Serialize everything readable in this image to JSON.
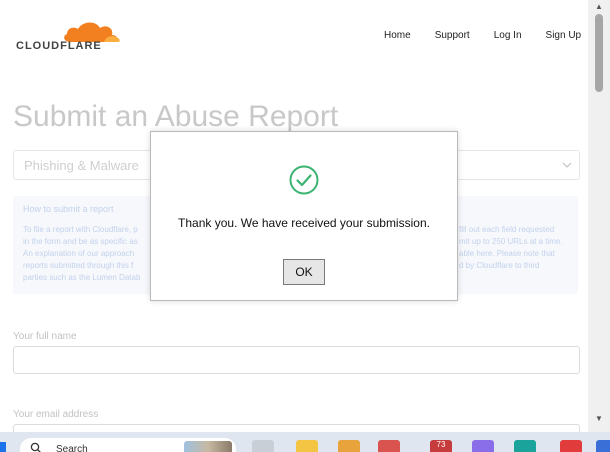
{
  "header": {
    "logo_text": "CLOUDFLARE",
    "nav": [
      "Home",
      "Support",
      "Log In",
      "Sign Up"
    ]
  },
  "main": {
    "title": "Submit an Abuse Report",
    "report_type_value": "Phishing & Malware",
    "info_title": "How to submit a report",
    "info_lines": [
      "To file a report with Cloudflare, p",
      "in the form and be as specific as",
      "An explanation of our approach",
      "reports submitted through this f",
      "parties such as the Lumen Datab"
    ],
    "info_lines_right": [
      "fill out each field requested",
      "mit up to 250 URLs at a time.",
      "able here. Please note that",
      "d by Cloudflare to third"
    ],
    "full_name_label": "Your full name",
    "email_label": "Your email address"
  },
  "modal": {
    "message": "Thank you. We have received your submission.",
    "ok_label": "OK"
  },
  "taskbar": {
    "search_text": "Search",
    "badge_count": "73"
  },
  "colors": {
    "cloudflare_orange": "#f38020",
    "success_green": "#3cb371"
  }
}
